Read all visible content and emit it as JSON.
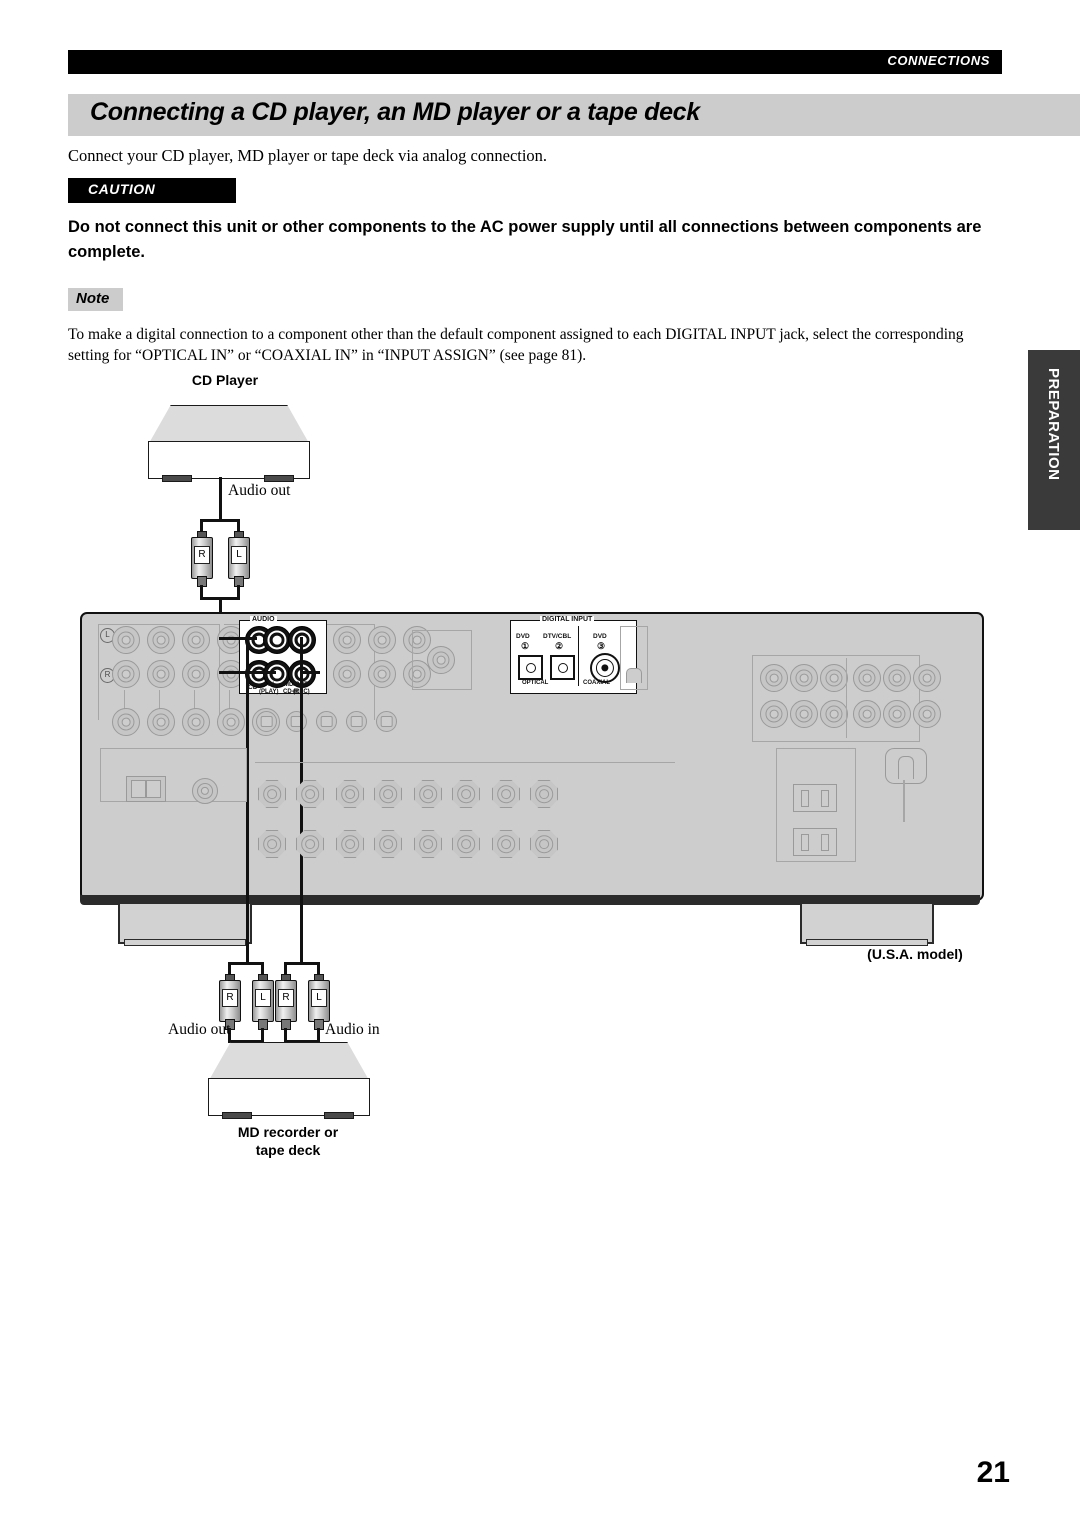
{
  "running_head": "CONNECTIONS",
  "title": "Connecting a CD player, an MD player or a tape deck",
  "intro": "Connect your CD player, MD player or tape deck via analog connection.",
  "caution": {
    "label": "CAUTION",
    "text": "Do not connect this unit or other components to the AC power supply until all connections between components are complete."
  },
  "note": {
    "label": "Note",
    "text": "To make a digital connection to a component other than the default component assigned to each DIGITAL INPUT jack, select the corresponding setting for “OPTICAL IN” or “COAXIAL IN” in “INPUT ASSIGN” (see page 81)."
  },
  "side_tab": "PREPARATION",
  "page_number": "21",
  "diagram": {
    "cd_player_label": "CD Player",
    "cd_audio_out": "Audio out",
    "md_label_line1": "MD recorder or",
    "md_label_line2": "tape deck",
    "md_audio_out": "Audio out",
    "md_audio_in": "Audio in",
    "usa_model": "(U.S.A. model)",
    "plug_right": "R",
    "plug_left": "L",
    "rear_panel": {
      "audio_group": "AUDIO",
      "cd_jack": "CD",
      "md_in_line1": "IN",
      "md_in_line2": "(PLAY)",
      "md_name": "MD/",
      "md_cdr": "CD-R",
      "md_out_line1": "OUT",
      "md_out_line2": "(REC)",
      "left_mark": "L",
      "right_mark": "R",
      "digital_input": {
        "title": "DIGITAL INPUT",
        "jack1_label": "DVD",
        "jack1_num": "①",
        "jack2_label": "DTV/CBL",
        "jack2_num": "②",
        "jack3_label": "DVD",
        "jack3_num": "③",
        "optical": "OPTICAL",
        "coaxial": "COAXIAL"
      }
    }
  },
  "colors": {
    "title_band": "#cccccc",
    "runhead": "#000000",
    "side_tab": "#3a3a3a",
    "panel": "#cdcdcd",
    "hot_jack": "#111111"
  }
}
